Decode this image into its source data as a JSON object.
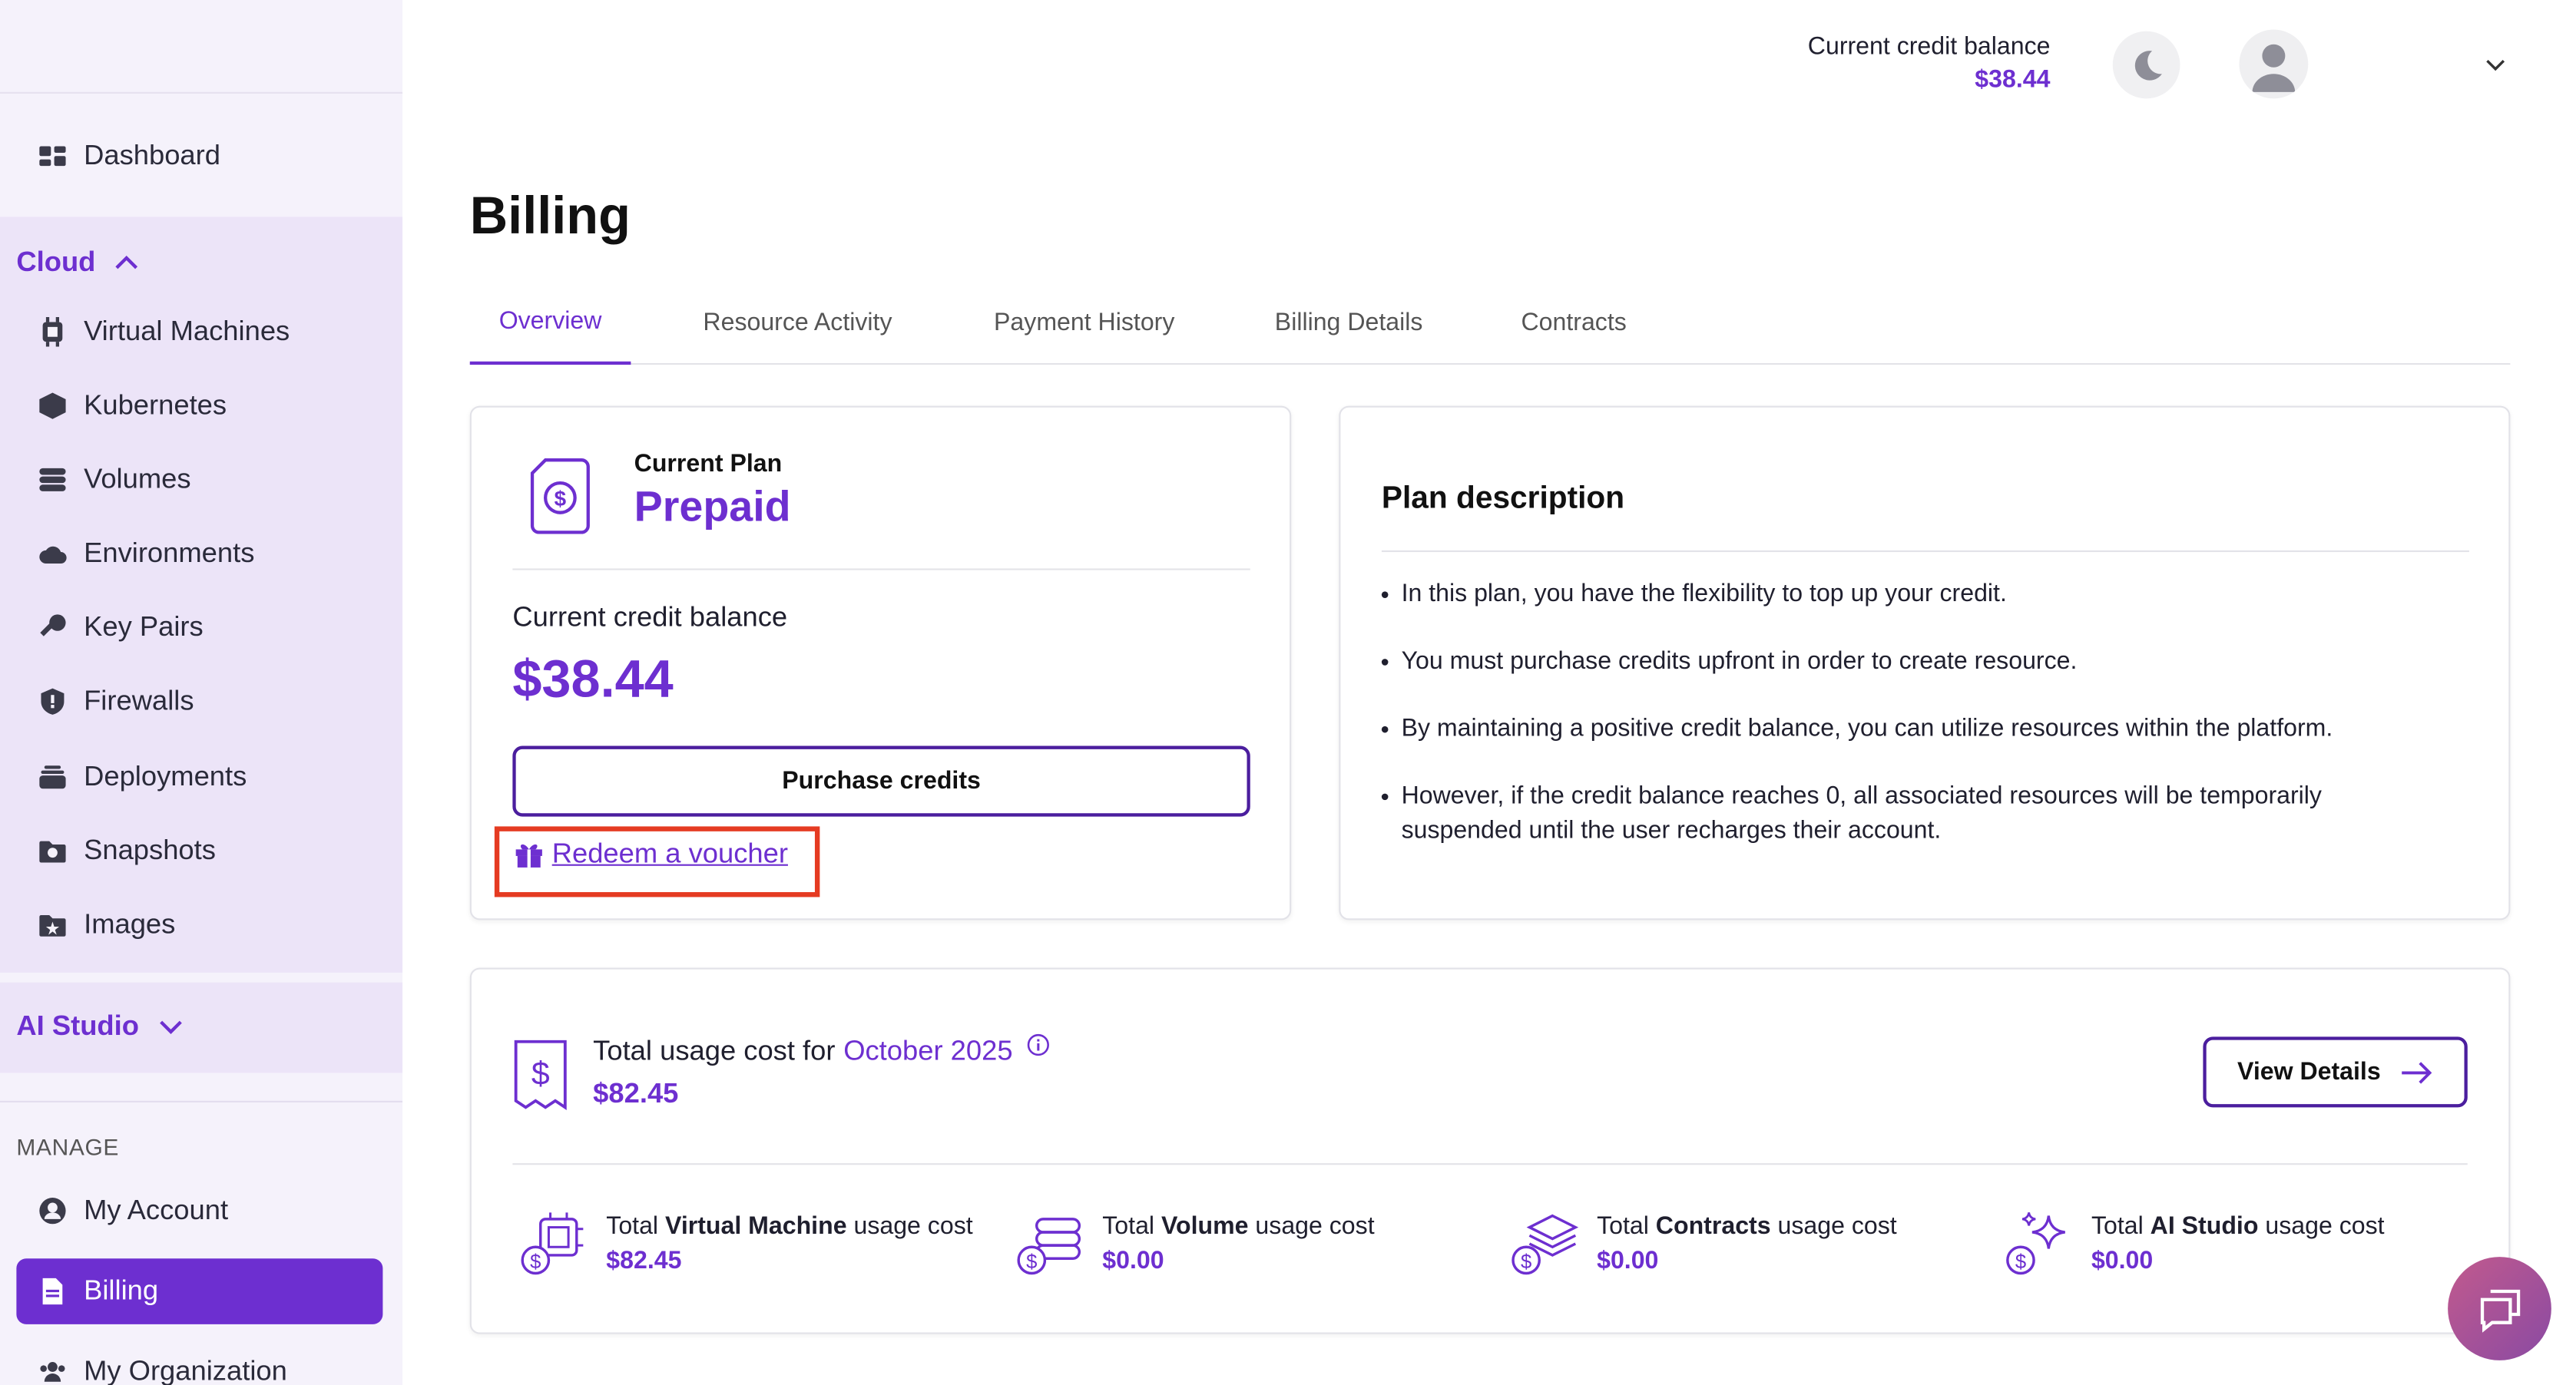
{
  "sidebar": {
    "items": [
      {
        "label": "Dashboard",
        "icon": "dashboard-icon"
      },
      {
        "label": "Virtual Machines",
        "icon": "chip-icon"
      },
      {
        "label": "Kubernetes",
        "icon": "cube-icon"
      },
      {
        "label": "Volumes",
        "icon": "storage-icon"
      },
      {
        "label": "Environments",
        "icon": "cloud-icon"
      },
      {
        "label": "Key Pairs",
        "icon": "key-icon"
      },
      {
        "label": "Firewalls",
        "icon": "shield-icon"
      },
      {
        "label": "Deployments",
        "icon": "stack-icon"
      },
      {
        "label": "Snapshots",
        "icon": "snapshot-icon"
      },
      {
        "label": "Images",
        "icon": "image-folder-icon"
      }
    ],
    "cloud_group": "Cloud",
    "ai_group": "AI Studio",
    "manage_section": "MANAGE",
    "manage_items": [
      {
        "label": "My Account",
        "icon": "user-circle-icon"
      },
      {
        "label": "Billing",
        "icon": "document-icon",
        "active": true
      },
      {
        "label": "My Organization",
        "icon": "team-icon"
      }
    ]
  },
  "header": {
    "balance_label": "Current credit balance",
    "balance_value": "$38.44"
  },
  "page": {
    "title": "Billing",
    "tabs": [
      "Overview",
      "Resource Activity",
      "Payment History",
      "Billing Details",
      "Contracts"
    ],
    "active_tab": "Overview"
  },
  "plan_card": {
    "label": "Current Plan",
    "name": "Prepaid",
    "balance_label": "Current credit balance",
    "balance_value": "$38.44",
    "purchase_button": "Purchase credits",
    "voucher_link": "Redeem a voucher"
  },
  "plan_description": {
    "title": "Plan description",
    "bullets": [
      "In this plan, you have the flexibility to top up your credit.",
      "You must purchase credits upfront in order to create resource.",
      "By maintaining a positive credit balance, you can utilize resources within the platform.",
      "However, if the credit balance reaches 0, all associated resources will be temporarily suspended until the user recharges their account."
    ]
  },
  "usage": {
    "title_prefix": "Total usage cost for",
    "month": "October 2025",
    "total": "$82.45",
    "view_button": "View Details",
    "metrics": [
      {
        "pre": "Total",
        "bold": "Virtual Machine",
        "post": "usage cost",
        "value": "$82.45"
      },
      {
        "pre": "Total",
        "bold": "Volume",
        "post": "usage cost",
        "value": "$0.00"
      },
      {
        "pre": "Total",
        "bold": "Contracts",
        "post": "usage cost",
        "value": "$0.00"
      },
      {
        "pre": "Total",
        "bold": "AI Studio",
        "post": "usage cost",
        "value": "$0.00"
      }
    ]
  },
  "colors": {
    "accent": "#6d2fd0",
    "accent_dark": "#4b1e9e",
    "sidebar_bg": "#f5f2fb",
    "sidebar_group_bg": "#ece4f8",
    "highlight_box": "#e53b22"
  }
}
